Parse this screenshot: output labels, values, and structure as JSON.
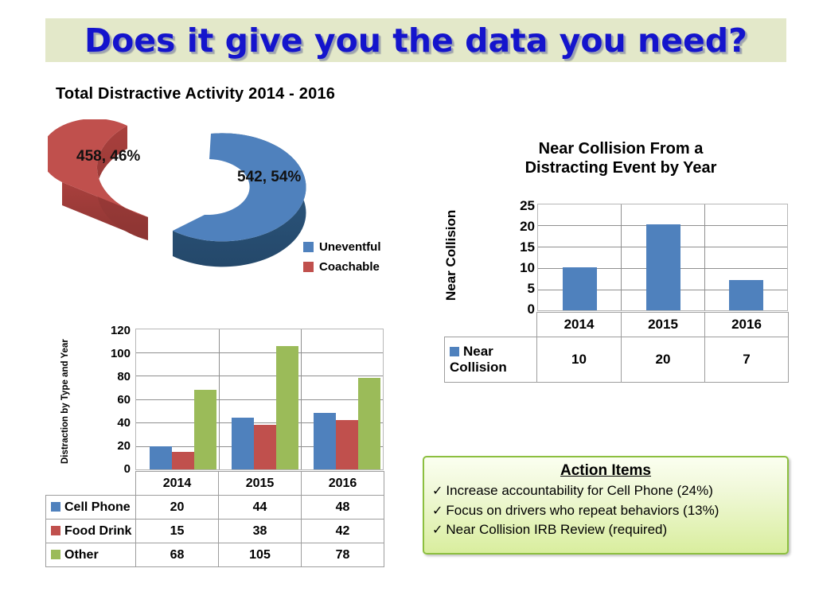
{
  "slide": {
    "title": "Does it give you the data you need?",
    "title_color": "#1414cc",
    "banner_color": "#e3e8c9"
  },
  "pie_section": {
    "heading": "Total Distractive Activity 2014 - 2016",
    "slice_label_coachable": "458, 46%",
    "slice_label_uneventful": "542, 54%",
    "legend": [
      {
        "label": "Uneventful",
        "color": "#4f81bd"
      },
      {
        "label": "Coachable",
        "color": "#c0504d"
      }
    ]
  },
  "near_collision": {
    "title_line1": "Near Collision From a",
    "title_line2": "Distracting Event by Year",
    "axis_title": "Near Collision",
    "ticks": [
      "25",
      "20",
      "15",
      "10",
      "5",
      "0"
    ],
    "years": [
      "2014",
      "2015",
      "2016"
    ],
    "series_label": "Near Collision",
    "series_color": "#4f81bd",
    "values": [
      "10",
      "20",
      "7"
    ]
  },
  "distraction": {
    "axis_title": "Distraction by Type and Year",
    "ticks": [
      "120",
      "100",
      "80",
      "60",
      "40",
      "20",
      "0"
    ],
    "years": [
      "2014",
      "2015",
      "2016"
    ],
    "rows": [
      {
        "label": "Cell Phone",
        "color": "#4f81bd",
        "values": [
          "20",
          "44",
          "48"
        ]
      },
      {
        "label": "Food Drink",
        "color": "#c0504d",
        "values": [
          "15",
          "38",
          "42"
        ]
      },
      {
        "label": "Other",
        "color": "#9bbb59",
        "values": [
          "68",
          "105",
          "78"
        ]
      }
    ]
  },
  "action_items": {
    "title": "Action Items",
    "check_glyph": "✓",
    "items": [
      "Increase accountability for Cell Phone (24%)",
      "Focus on drivers who repeat behaviors (13%)",
      "Near Collision IRB Review (required)"
    ]
  },
  "chart_data": [
    {
      "type": "pie",
      "title": "Total Distractive Activity 2014 - 2016",
      "labels": [
        "Uneventful",
        "Coachable"
      ],
      "values": [
        542,
        458
      ],
      "percents": [
        54,
        46
      ],
      "data_labels": [
        "542, 54%",
        "458, 46%"
      ],
      "colors": [
        "#4f81bd",
        "#c0504d"
      ],
      "exploded": [
        "Coachable"
      ],
      "three_d": true,
      "legend_position": "right"
    },
    {
      "type": "bar",
      "title": "Near Collision From a Distracting Event by Year",
      "categories": [
        "2014",
        "2015",
        "2016"
      ],
      "series": [
        {
          "name": "Near Collision",
          "values": [
            10,
            20,
            7
          ],
          "color": "#4f81bd"
        }
      ],
      "xlabel": "",
      "ylabel": "Near Collision",
      "ylim": [
        0,
        25
      ],
      "ytick_step": 5,
      "grid": true,
      "data_table": true,
      "legend_position": "table"
    },
    {
      "type": "bar",
      "title": "",
      "categories": [
        "2014",
        "2015",
        "2016"
      ],
      "series": [
        {
          "name": "Cell Phone",
          "values": [
            20,
            44,
            48
          ],
          "color": "#4f81bd"
        },
        {
          "name": "Food Drink",
          "values": [
            15,
            38,
            42
          ],
          "color": "#c0504d"
        },
        {
          "name": "Other",
          "values": [
            68,
            105,
            78
          ],
          "color": "#9bbb59"
        }
      ],
      "xlabel": "",
      "ylabel": "Distraction by Type and Year",
      "ylim": [
        0,
        120
      ],
      "ytick_step": 20,
      "grid": true,
      "data_table": true,
      "legend_position": "table"
    }
  ]
}
